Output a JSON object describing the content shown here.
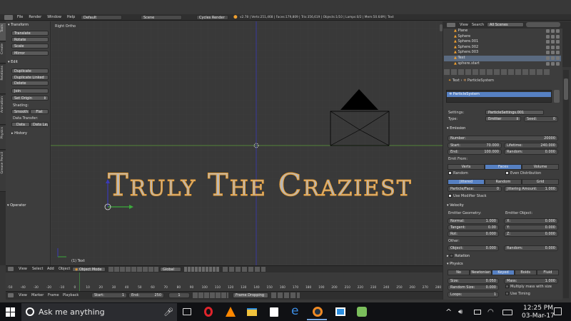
{
  "topbar": {
    "menus": [
      "File",
      "Render",
      "Window",
      "Help"
    ],
    "layout": "Default",
    "scene": "Scene",
    "engine": "Cycles Render",
    "stats": "v2.78 | Verts:251,468 | Faces:179,809 | Tris:356,619 | Objects:1/10 | Lamps:0/2 | Mem:50.64M | Text"
  },
  "left_tabs": [
    "Tools",
    "Create",
    "Relations",
    "Animation",
    "Physics",
    "Grease Pencil"
  ],
  "tool": {
    "transform_title": "Transform",
    "transform": [
      "Translate",
      "Rotate",
      "Scale",
      "Mirror"
    ],
    "edit_title": "Edit",
    "edit": [
      "Duplicate",
      "Duplicate Linked",
      "Delete",
      "Join"
    ],
    "origin": "Set Origin",
    "shading_title": "Shading:",
    "smooth": "Smooth",
    "flat": "Flat",
    "data_transfer_title": "Data Transfer:",
    "data": "Data",
    "data_layout": "Data Layo",
    "history_title": "History",
    "operator_title": "Operator"
  },
  "viewport": {
    "view_name": "Right Ortho",
    "object_name": "(1) Text",
    "text3d": "Truly The Craziest"
  },
  "view_header": {
    "view": "View",
    "select": "Select",
    "add": "Add",
    "object": "Object",
    "mode": "Object Mode",
    "global": "Global"
  },
  "timeline": {
    "ticks": [
      "-50",
      "-40",
      "-30",
      "-20",
      "-10",
      "0",
      "10",
      "20",
      "30",
      "40",
      "50",
      "60",
      "70",
      "80",
      "90",
      "100",
      "110",
      "120",
      "130",
      "140",
      "150",
      "160",
      "170",
      "180",
      "190",
      "200",
      "210",
      "220",
      "230",
      "240",
      "250",
      "260",
      "270",
      "280"
    ],
    "view": "View",
    "marker": "Marker",
    "frame": "Frame",
    "playback": "Playback",
    "start_label": "Start:",
    "start_val": "1",
    "end_label": "End:",
    "end_val": "250",
    "current": "1",
    "sync": "Frame Dropping"
  },
  "outliner": {
    "view": "View",
    "search": "Search",
    "scenes": "All Scenes",
    "items": [
      "Plane",
      "Sphere",
      "Sphere.001",
      "Sphere.002",
      "Sphere.003",
      "Text",
      "sphere.start"
    ]
  },
  "props": {
    "breadcrumb": [
      "Text",
      "ParticleSystem"
    ],
    "particle_system": "ParticleSystem",
    "settings_label": "Settings:",
    "settings_val": "ParticleSettings.001",
    "type_label": "Type:",
    "type_val": "Emitter",
    "seed_label": "Seed:",
    "seed_val": "0",
    "emission_title": "Emission",
    "number_label": "Number:",
    "number_val": "20000",
    "start_label": "Start:",
    "start_val": "70.000",
    "end_label": "End:",
    "end_val": "100.000",
    "lifetime_label": "Lifetime:",
    "lifetime_val": "240.000",
    "random_label": "Random:",
    "random_val": "0.000",
    "emit_from": "Emit From:",
    "verts": "Verts",
    "faces": "Faces",
    "volume": "Volume",
    "random_cb": "Random",
    "even_dist": "Even Distribution",
    "jittered": "Jittered",
    "random_tab": "Random",
    "grid": "Grid",
    "ppf_label": "Particle/Face:",
    "ppf_val": "0",
    "jitter_label": "Jittering Amount:",
    "jitter_val": "1.000",
    "use_modifier": "Use Modifier Stack",
    "velocity_title": "Velocity",
    "emitter_geometry": "Emitter Geometry:",
    "emitter_object": "Emitter Object:",
    "normal_label": "Normal:",
    "normal_val": "1.000",
    "tangent_label": "Tangent:",
    "tangent_val": "0.00",
    "rot_label": "Rot:",
    "rot_val": "0.000",
    "x_label": "X:",
    "x_val": "0.000",
    "y_label": "Y:",
    "y_val": "0.000",
    "z_label": "Z:",
    "z_val": "0.000",
    "other_label": "Other:",
    "object_label": "Object:",
    "object_val": "0.000",
    "random2_label": "Random:",
    "random2_val": "0.000",
    "rotation_title": "Rotation",
    "physics_title": "Physics",
    "phys_tabs": [
      "No",
      "Newtonian",
      "Keyed",
      "Boids",
      "Fluid"
    ],
    "size_label": "Size:",
    "size_val": "0.050",
    "mass_label": "Mass:",
    "mass_val": "1.000",
    "rsize_label": "Random Size:",
    "rsize_val": "0.000",
    "multiply_mass": "Multiply mass with size",
    "loops_label": "Loops:",
    "loops_val": "1",
    "use_timing": "Use Timing"
  },
  "taskbar": {
    "search": "Ask me anything",
    "time": "12:25 PM",
    "date": "03-Mar-17"
  },
  "colors": {
    "accent": "#5680c2",
    "selected_orange": "#f0a030",
    "x_axis": "#5c9c3a",
    "z_axis": "#3a3ab8"
  }
}
